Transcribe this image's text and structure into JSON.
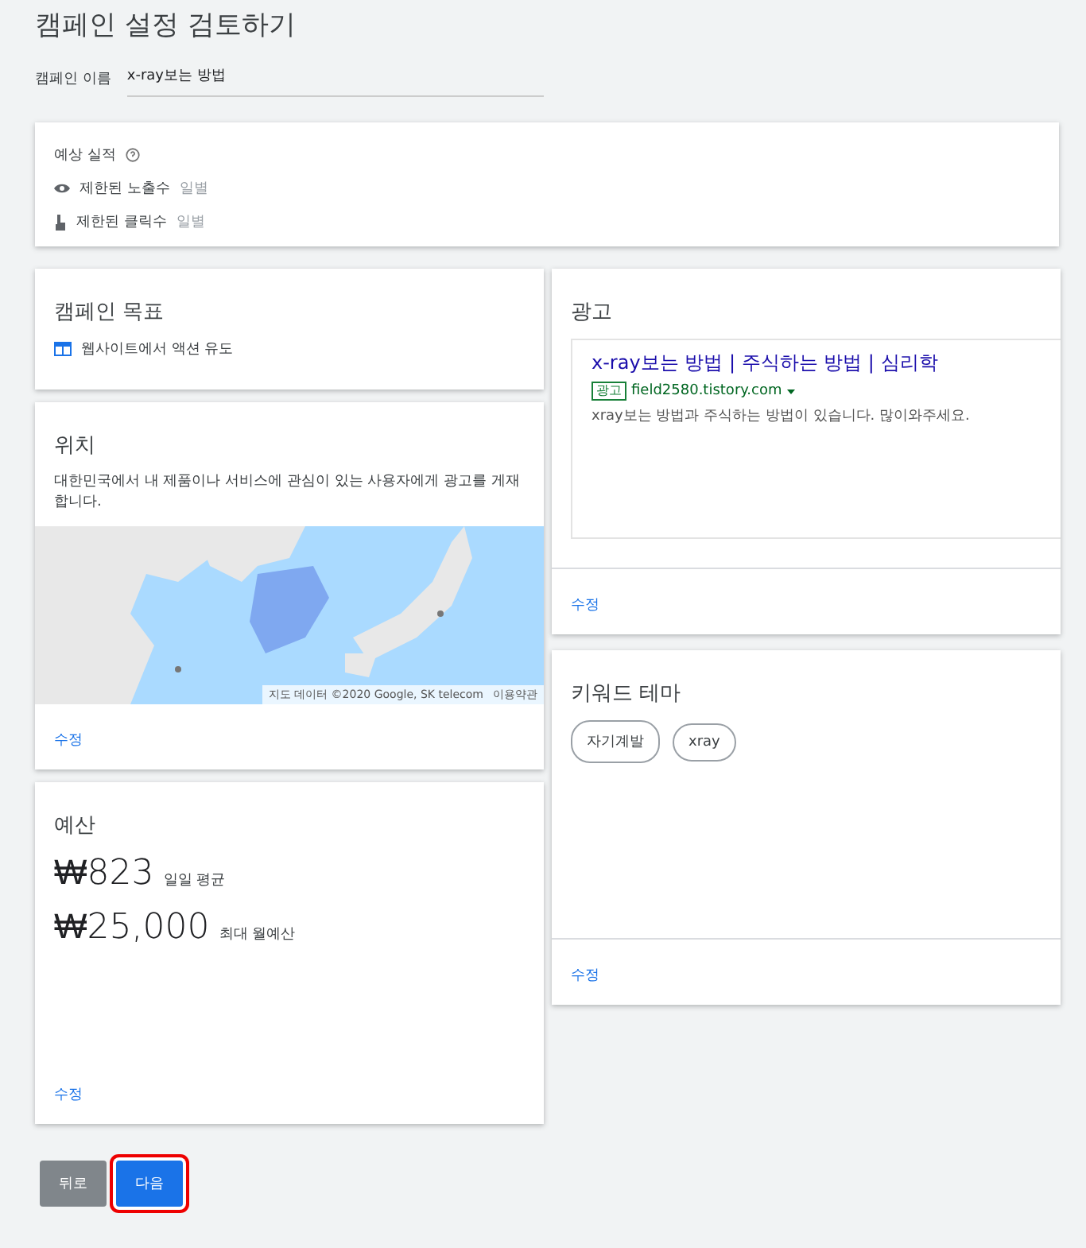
{
  "title": "캠페인 설정 검토하기",
  "campaign_name": {
    "label": "캠페인 이름",
    "value": "x-ray보는 방법"
  },
  "performance": {
    "title": "예상 실적",
    "rows": [
      {
        "kind": "impressions",
        "label": "제한된 노출수",
        "unit": "일별"
      },
      {
        "kind": "clicks",
        "label": "제한된 클릭수",
        "unit": "일별"
      }
    ]
  },
  "goal": {
    "title": "캠페인 목표",
    "value": "웹사이트에서 액션 유도"
  },
  "location": {
    "title": "위치",
    "description": "대한민국에서 내 제품이나 서비스에 관심이 있는 사용자에게 광고를 게재합니다.",
    "map": {
      "kind": "picture",
      "attribution": "지도 데이터 ©2020 Google, SK telecom",
      "terms": "이용약관"
    },
    "edit": "수정"
  },
  "budget": {
    "title": "예산",
    "daily": {
      "amount": "₩823",
      "label": "일일 평균"
    },
    "monthly": {
      "amount": "₩25,000",
      "label": "최대 월예산"
    },
    "edit": "수정"
  },
  "ad": {
    "title": "광고",
    "headline": "x-ray보는 방법 | 주식하는 방법 | 심리학",
    "badge": "광고",
    "url": "field2580.tistory.com",
    "description": "xray보는 방법과 주식하는 방법이 있습니다. 많이와주세요.",
    "edit": "수정"
  },
  "keywords": {
    "title": "키워드 테마",
    "chips": [
      "자기계발",
      "xray"
    ],
    "edit": "수정"
  },
  "buttons": [
    {
      "label": "뒤로",
      "kind": "secondary",
      "highlighted": false
    },
    {
      "label": "다음",
      "kind": "primary",
      "highlighted": true
    }
  ]
}
